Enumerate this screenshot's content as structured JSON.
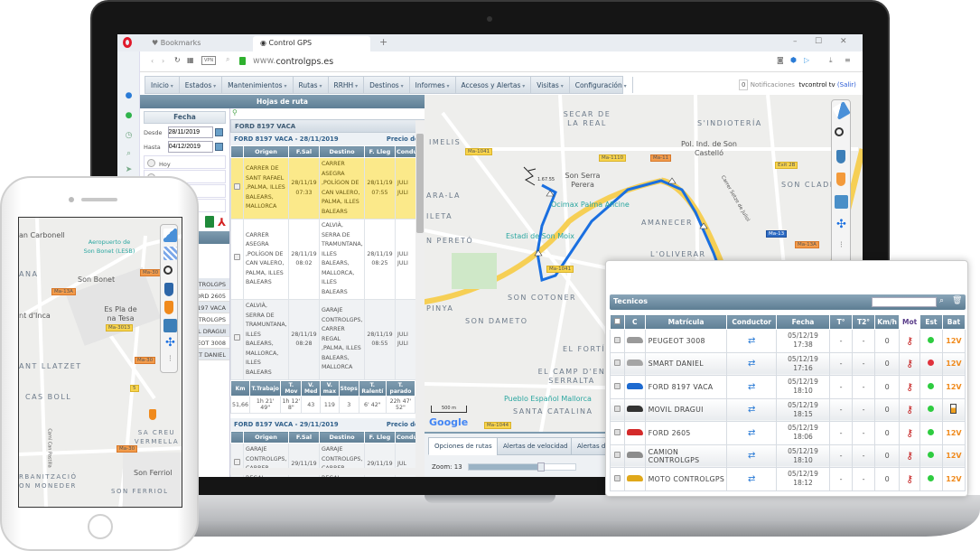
{
  "browser": {
    "tabs": [
      {
        "label": "Bookmarks",
        "icon": "heart-icon"
      },
      {
        "label": "Control GPS",
        "icon": "globe-icon"
      }
    ],
    "new_tab": "+",
    "url": "www.controlgps.es",
    "url_domain_prefix": "www.",
    "vpn_label": "VPN"
  },
  "menu": {
    "items": [
      "Inicio",
      "Estados",
      "Mantenimientos",
      "Rutas",
      "RRHH",
      "Destinos",
      "Informes",
      "Accesos y Alertas",
      "Visitas",
      "Configuración"
    ],
    "notif_count": "0",
    "notif_label": "Notificaciones",
    "user": "tvcontrol tv",
    "logout": "(Salir)"
  },
  "hojas": {
    "title": "Hojas de ruta",
    "fecha_title": "Fecha",
    "desde_label": "Desde",
    "desde": "28/11/2019",
    "hasta_label": "Hasta",
    "hasta": "04/12/2019",
    "options": [
      "Hoy"
    ],
    "vehicles": [
      "CAMION CONTROLGPS",
      "FORD 2605",
      "FORD 8197 VACA",
      "MOTO CONTROLGPS",
      "MOVIL DRAGUI",
      "PEUGEOT 3008",
      "SMART DANIEL"
    ],
    "vehicle_title": "FORD 8197 VACA",
    "price_label": "Precio del",
    "columns": [
      "",
      "Origen",
      "F.Sal",
      "Destino",
      "F. Lleg",
      "Condu"
    ],
    "days": [
      {
        "title": "FORD 8197 VACA - 28/11/2019",
        "rows": [
          {
            "origen": "CARRER DE SANT RAFAEL ,PALMA, ILLES BALEARS, MALLORCA",
            "fsal": "28/11/19 07:33",
            "destino": "CARRER ASEGRA ,POLÍGON DE CAN VALERO, PALMA, ILLES BALEARS",
            "flleg": "28/11/19 07:55",
            "cond": "JULI JULI",
            "highlight": true
          },
          {
            "origen": "CARRER ASEGRA ,POLÍGON DE CAN VALERO, PALMA, ILLES BALEARS",
            "fsal": "28/11/19 08:02",
            "destino": "CALVIÀ, SERRA DE TRAMUNTANA, ILLES BALEARS, MALLORCA, ILLES BALEARS",
            "flleg": "28/11/19 08:25",
            "cond": "JULI JULI",
            "highlight": false
          },
          {
            "origen": "CALVIÀ, SERRA DE TRAMUNTANA, ILLES BALEARS, MALLORCA, ILLES BALEARS",
            "fsal": "28/11/19 08:28",
            "destino": "GARAJE CONTROLGPS, CARRER REGAL ,PALMA, ILLES BALEARS, MALLORCA",
            "flleg": "28/11/19 08:55",
            "cond": "JULI JULI",
            "highlight": false
          }
        ],
        "summary_headers": [
          "Km",
          "T.Trabajo",
          "T. Mov",
          "V. Med",
          "V. max",
          "Stops",
          "T. Ralentí",
          "T. parado"
        ],
        "summary": [
          "51,66",
          "1h 21' 49\"",
          "1h 12' 8\"",
          "43",
          "119",
          "3",
          "6' 42\"",
          "22h 47' 52\""
        ]
      },
      {
        "title": "FORD 8197 VACA - 29/11/2019",
        "rows": [
          {
            "origen": "GARAJE CONTROLGPS, CARRER REGAL",
            "fsal": "29/11/19",
            "destino": "GARAJE CONTROLGPS, CARRER REGAL",
            "flleg": "29/11/19",
            "cond": "JUL",
            "highlight": false
          }
        ]
      }
    ]
  },
  "map": {
    "labels": [
      "SECAR DE LA REAL",
      "S'INDIOTERÍA",
      "IMELIS",
      "Pol. Ind. de Son Castelló",
      "Son Serra Perera",
      "AMANECER",
      "SON CLADE",
      "N PERETÓ",
      "L'OLIVERAR",
      "SON COTONER",
      "PINYA",
      "SON DAMETO",
      "EL FORTÍ",
      "EL CAMP D'EN SERRALTA",
      "SANTA CATALINA",
      "ARA-LA",
      "ILETA",
      "Carrer Setze de Juliol"
    ],
    "pois": [
      "Ocimax Palma Aficine",
      "Estadi de Son Moix",
      "Pueblo Español Mallorca"
    ],
    "road_signs": [
      "Ma-1041",
      "Ma-1110",
      "Ma-11",
      "Ma-13",
      "Exit 2B",
      "Ma-13A",
      "Ma-1041",
      "Ma-1044"
    ],
    "route_color": "#1a6fe0",
    "route_marker": "1.67.55",
    "scale": "500 m",
    "google": "Google",
    "tabs": [
      "Opciones de rutas",
      "Alertas de velocidad",
      "Alertas de"
    ],
    "zoom_label": "Zoom: 13",
    "zoom_level": 13,
    "zoom_fraction": 0.68,
    "tools": [
      "eraser-icon",
      "grid-icon",
      "magnifier-icon",
      "blue-marker-icon",
      "orange-marker-icon",
      "building-icon",
      "expand-icon",
      "traffic-light-icon"
    ]
  },
  "tecnicos": {
    "title": "Tecnicos",
    "columns": [
      "",
      "C",
      "Matrícula",
      "Conductor",
      "Fecha",
      "T°",
      "T2°",
      "Km/h",
      "Mot",
      "Est",
      "Bat"
    ],
    "rows": [
      {
        "matricula": "PEUGEOT 3008",
        "fecha": "05/12/19 17:38",
        "t": "-",
        "t2": "-",
        "kmh": "0",
        "est": "green",
        "bat": "12V",
        "veh": "#9a9a9a"
      },
      {
        "matricula": "SMART DANIEL",
        "fecha": "05/12/19 17:16",
        "t": "-",
        "t2": "-",
        "kmh": "0",
        "est": "red",
        "bat": "12V",
        "veh": "#a5a5a5"
      },
      {
        "matricula": "FORD 8197 VACA",
        "fecha": "05/12/19 18:10",
        "t": "-",
        "t2": "-",
        "kmh": "0",
        "est": "green",
        "bat": "12V",
        "veh": "#1d6ad0"
      },
      {
        "matricula": "MOVIL DRAGUI",
        "fecha": "05/12/19 18:15",
        "t": "-",
        "t2": "-",
        "kmh": "0",
        "est": "green",
        "bat": "battery",
        "veh": "#333"
      },
      {
        "matricula": "FORD 2605",
        "fecha": "05/12/19 18:06",
        "t": "-",
        "t2": "-",
        "kmh": "0",
        "est": "green",
        "bat": "12V",
        "veh": "#d42a2a"
      },
      {
        "matricula": "CAMION CONTROLGPS",
        "fecha": "05/12/19 18:10",
        "t": "-",
        "t2": "-",
        "kmh": "0",
        "est": "green",
        "bat": "12V",
        "veh": "#8c8c8c"
      },
      {
        "matricula": "MOTO CONTROLGPS",
        "fecha": "05/12/19 18:12",
        "t": "-",
        "t2": "-",
        "kmh": "0",
        "est": "green",
        "bat": "12V",
        "veh": "#e0a81a"
      }
    ],
    "colors": {
      "green": "#2ecc40",
      "red": "#e0323c"
    }
  },
  "phone_map": {
    "labels": [
      "an Carbonell",
      "Son Bonet",
      "ANA",
      "nt d'Inca",
      "Es Pla de na Tesa",
      "ANT LLATZET",
      "CAS BOLL",
      "SA CREU VERMELLA",
      "Camí Can Pastilla",
      "RBANITZACIÓ ON MONEDER",
      "Son Ferriol",
      "SON FERRIOL"
    ],
    "pois": [
      "Aeropuerto de Son Bonet (LESB)"
    ],
    "road_signs": [
      "Ma-13A",
      "Ma-30",
      "Ma-3013",
      "Ma-30",
      "5",
      "Ma-30"
    ]
  }
}
